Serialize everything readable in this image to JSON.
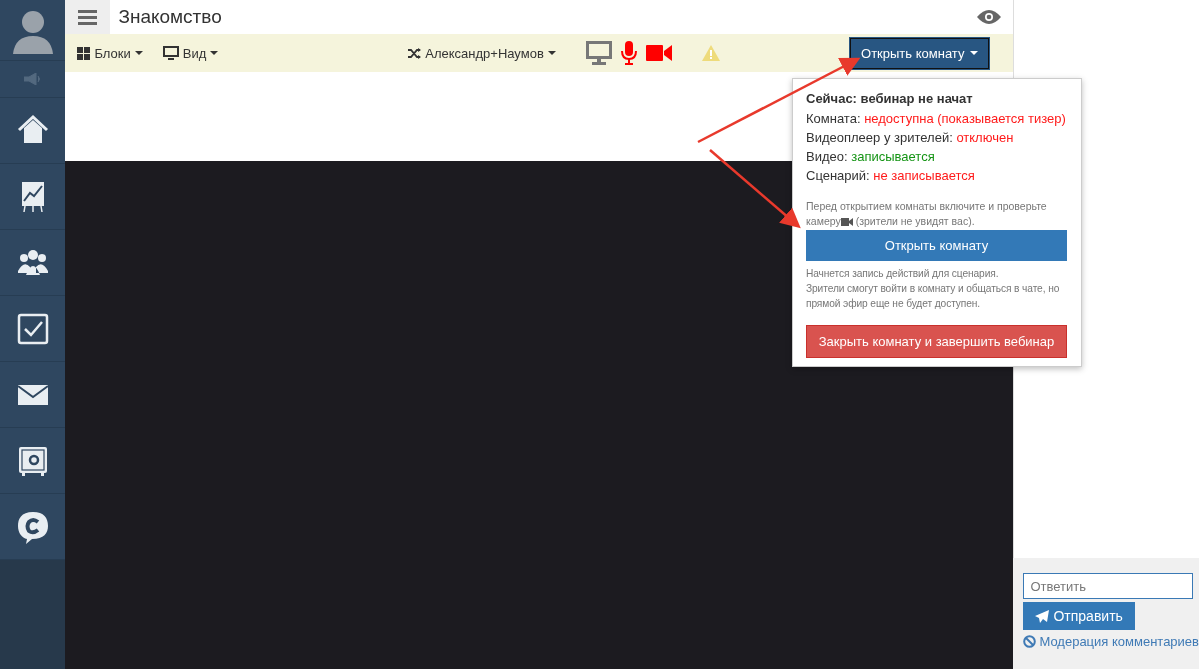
{
  "header": {
    "title": "Знакомство"
  },
  "toolbar": {
    "blocks": "Блоки",
    "view": "Вид",
    "speaker": "Александр+Наумов",
    "open_button": "Открыть комнату"
  },
  "popover": {
    "heading": "Сейчас: вебинар не начат",
    "statuses": [
      {
        "label": "Комната:",
        "value": "недоступна (показывается тизер)",
        "color": "#ff1a1a"
      },
      {
        "label": "Видеоплеер у зрителей:",
        "value": "отключен",
        "color": "#ff1a1a"
      },
      {
        "label": "Видео:",
        "value": "записывается",
        "color": "#149414"
      },
      {
        "label": "Сценарий:",
        "value": "не записывается",
        "color": "#ff1a1a"
      }
    ],
    "hint_line1": "Перед открытием комнаты включите и проверьте",
    "hint_before": "камеру",
    "hint_after": "(зрители не увидят вас).",
    "open_button": "Открыть комнату",
    "note": "Начнется запись действий для сценария.\nЗрители смогут войти в комнату и общаться в чате, но прямой эфир еще не будет доступен.",
    "close_button": "Закрыть комнату и завершить вебинар"
  },
  "chat": {
    "placeholder": "Ответить",
    "send_button": "Отправить",
    "moderation_link": "Модерация комментариев"
  }
}
